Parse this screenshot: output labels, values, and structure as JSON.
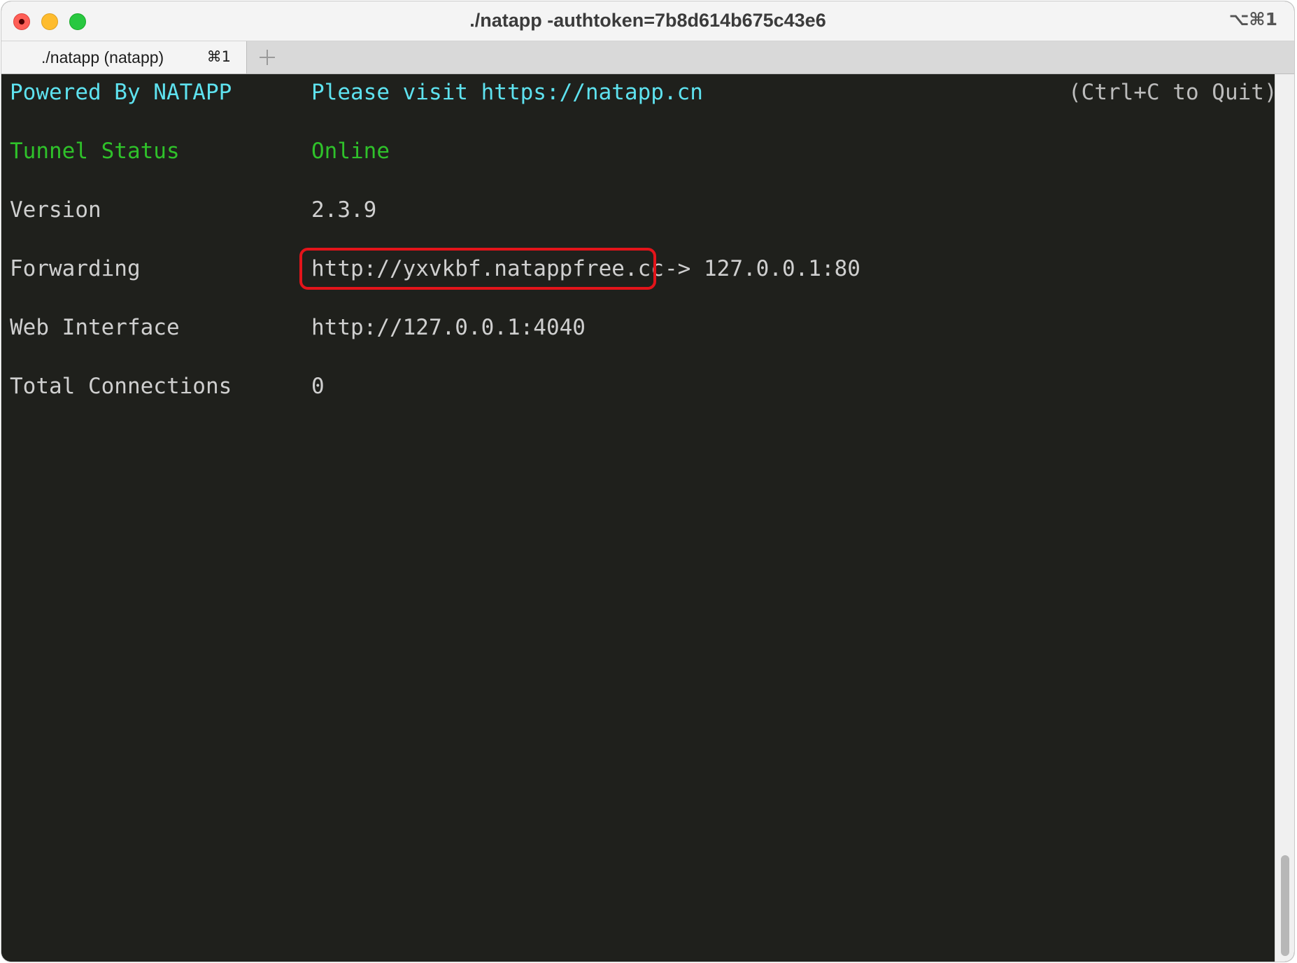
{
  "window": {
    "title": "./natapp -authtoken=7b8d614b675c43e6",
    "shortcut": "⌥⌘1"
  },
  "tabs": [
    {
      "label": "./natapp (natapp)",
      "shortcut": "⌘1",
      "active": true
    }
  ],
  "new_tab_icon": "plus-icon",
  "terminal": {
    "powered_by": "Powered By NATAPP",
    "visit": "Please visit https://natapp.cn",
    "quit_hint": "(Ctrl+C to Quit)",
    "rows": [
      {
        "label": "Tunnel Status",
        "value": "Online"
      },
      {
        "label": "Version",
        "value": "2.3.9"
      },
      {
        "label": "Forwarding",
        "value": "http://yxvkbf.natappfree.cc",
        "suffix": "-> 127.0.0.1:80"
      },
      {
        "label": "Web Interface",
        "value": "http://127.0.0.1:4040"
      },
      {
        "label": "Total Connections",
        "value": "0"
      }
    ]
  },
  "colors": {
    "terminal_bg": "#1f201c",
    "cyan_text": "#5ee2ef",
    "green_text": "#2fc12a",
    "default_text": "#cfcfcf",
    "highlight_border": "#e3141a"
  }
}
